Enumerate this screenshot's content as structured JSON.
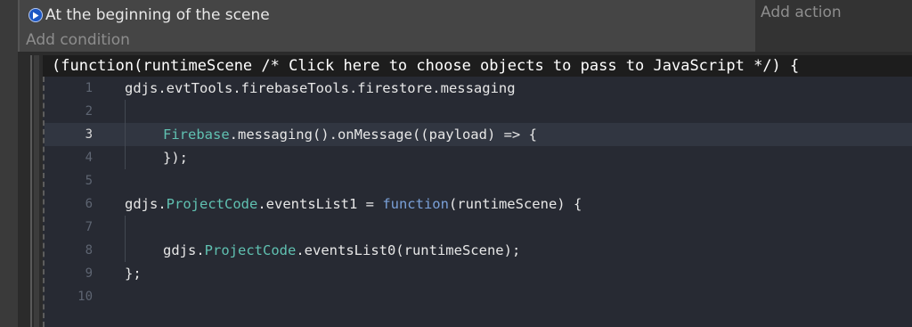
{
  "event": {
    "condition_text": "At the beginning of the scene",
    "add_condition": "Add condition",
    "add_action": "Add action"
  },
  "js_event": {
    "header": "(function(runtimeScene /* Click here to choose objects to pass to JavaScript */) {",
    "active_line": 3,
    "lines": [
      {
        "num": "1",
        "indent": 0,
        "tokens": [
          {
            "t": "gdjs.evtTools.firebaseTools.firestore.messaging",
            "c": "plain"
          }
        ]
      },
      {
        "num": "2",
        "indent": 1,
        "tokens": []
      },
      {
        "num": "3",
        "indent": 1,
        "tokens": [
          {
            "t": "Firebase",
            "c": "fn"
          },
          {
            "t": ".messaging().onMessage((payload) => {",
            "c": "plain"
          }
        ]
      },
      {
        "num": "4",
        "indent": 1,
        "tokens": [
          {
            "t": "});",
            "c": "plain"
          }
        ]
      },
      {
        "num": "5",
        "indent": 0,
        "tokens": []
      },
      {
        "num": "6",
        "indent": 0,
        "tokens": [
          {
            "t": "gdjs.",
            "c": "plain"
          },
          {
            "t": "ProjectCode",
            "c": "fn"
          },
          {
            "t": ".eventsList1 = ",
            "c": "plain"
          },
          {
            "t": "function",
            "c": "kw"
          },
          {
            "t": "(runtimeScene) {",
            "c": "plain"
          }
        ]
      },
      {
        "num": "7",
        "indent": 1,
        "tokens": []
      },
      {
        "num": "8",
        "indent": 1,
        "tokens": [
          {
            "t": "gdjs.",
            "c": "plain"
          },
          {
            "t": "ProjectCode",
            "c": "fn"
          },
          {
            "t": ".eventsList0(runtimeScene);",
            "c": "plain"
          }
        ]
      },
      {
        "num": "9",
        "indent": 0,
        "tokens": [
          {
            "t": "};",
            "c": "plain"
          }
        ]
      },
      {
        "num": "10",
        "indent": 0,
        "tokens": []
      }
    ]
  }
}
